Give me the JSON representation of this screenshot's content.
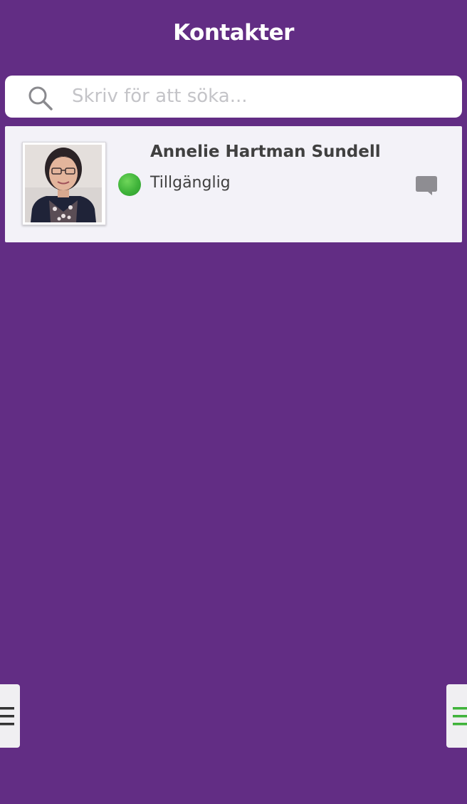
{
  "header": {
    "title": "Kontakter"
  },
  "search": {
    "placeholder": "Skriv för att söka...",
    "value": "",
    "icon": "search-icon"
  },
  "contacts": [
    {
      "name": "Annelie Hartman Sundell",
      "status": "Tillgänglig",
      "status_color": "#3fb33a",
      "action_icon": "chat-bubble-icon"
    }
  ],
  "side_tabs": {
    "left_icon": "menu-icon",
    "left_color": "#333333",
    "right_icon": "menu-icon",
    "right_color": "#3fb33a"
  },
  "colors": {
    "background": "#622d84",
    "row_background": "#f3f2f8",
    "search_background": "#ffffff"
  }
}
